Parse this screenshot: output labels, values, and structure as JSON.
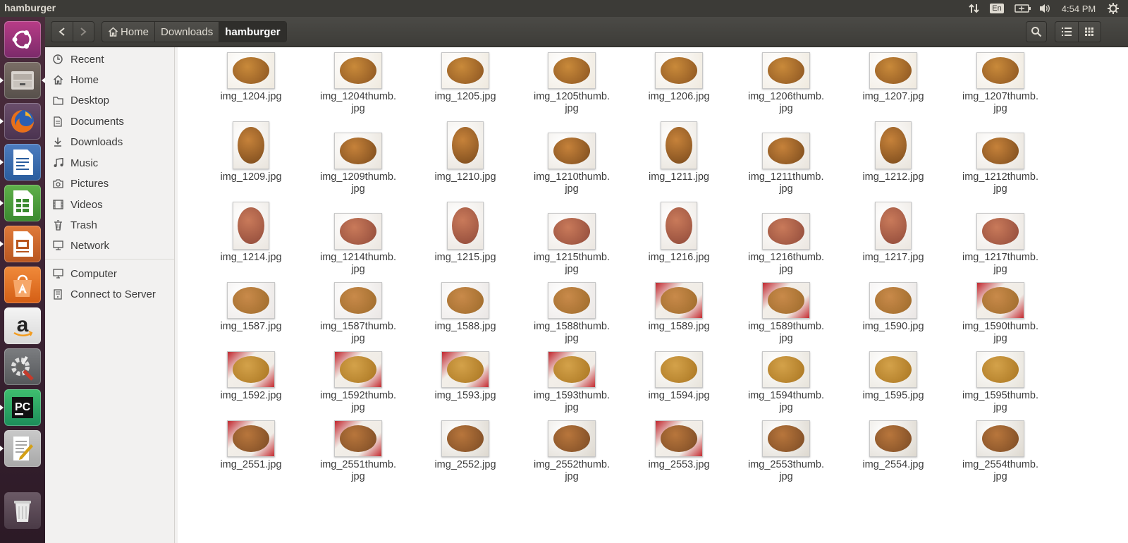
{
  "window": {
    "title": "hamburger"
  },
  "panel": {
    "keyboard_layout": "En",
    "clock": "4:54 PM"
  },
  "launcher": {
    "items": [
      {
        "name": "ubuntu-dash-icon"
      },
      {
        "name": "files-icon"
      },
      {
        "name": "firefox-icon"
      },
      {
        "name": "writer-icon"
      },
      {
        "name": "calc-icon"
      },
      {
        "name": "impress-icon"
      },
      {
        "name": "software-center-icon"
      },
      {
        "name": "amazon-icon"
      },
      {
        "name": "system-settings-icon"
      },
      {
        "name": "pycharm-icon"
      },
      {
        "name": "text-editor-icon"
      },
      {
        "name": "trash-icon"
      }
    ]
  },
  "breadcrumb": {
    "items": [
      "Home",
      "Downloads",
      "hamburger"
    ]
  },
  "sidebar": {
    "places": [
      {
        "label": "Recent",
        "icon": "clock-icon"
      },
      {
        "label": "Home",
        "icon": "home-icon"
      },
      {
        "label": "Desktop",
        "icon": "folder-icon"
      },
      {
        "label": "Documents",
        "icon": "document-icon"
      },
      {
        "label": "Downloads",
        "icon": "download-icon"
      },
      {
        "label": "Music",
        "icon": "music-icon"
      },
      {
        "label": "Pictures",
        "icon": "camera-icon"
      },
      {
        "label": "Videos",
        "icon": "video-icon"
      },
      {
        "label": "Trash",
        "icon": "trash-icon"
      },
      {
        "label": "Network",
        "icon": "network-icon"
      }
    ],
    "devices": [
      {
        "label": "Computer",
        "icon": "computer-icon"
      },
      {
        "label": "Connect to Server",
        "icon": "server-icon"
      }
    ]
  },
  "files": [
    [
      "img_1204.jpg",
      "img_1204thumb.jpg",
      "img_1205.jpg",
      "img_1205thumb.jpg",
      "img_1206.jpg",
      "img_1206thumb.jpg",
      "img_1207.jpg",
      "img_1207thumb.jpg"
    ],
    [
      "img_1209.jpg",
      "img_1209thumb.jpg",
      "img_1210.jpg",
      "img_1210thumb.jpg",
      "img_1211.jpg",
      "img_1211thumb.jpg",
      "img_1212.jpg",
      "img_1212thumb.jpg"
    ],
    [
      "img_1214.jpg",
      "img_1214thumb.jpg",
      "img_1215.jpg",
      "img_1215thumb.jpg",
      "img_1216.jpg",
      "img_1216thumb.jpg",
      "img_1217.jpg",
      "img_1217thumb.jpg"
    ],
    [
      "img_1587.jpg",
      "img_1587thumb.jpg",
      "img_1588.jpg",
      "img_1588thumb.jpg",
      "img_1589.jpg",
      "img_1589thumb.jpg",
      "img_1590.jpg",
      "img_1590thumb.jpg"
    ],
    [
      "img_1592.jpg",
      "img_1592thumb.jpg",
      "img_1593.jpg",
      "img_1593thumb.jpg",
      "img_1594.jpg",
      "img_1594thumb.jpg",
      "img_1595.jpg",
      "img_1595thumb.jpg"
    ],
    [
      "img_2551.jpg",
      "img_2551thumb.jpg",
      "img_2552.jpg",
      "img_2552thumb.jpg",
      "img_2553.jpg",
      "img_2553thumb.jpg",
      "img_2554.jpg",
      "img_2554thumb.jpg"
    ]
  ],
  "colors": {
    "launcher_bg": "#3a2232",
    "panel_bg": "#3c3b37",
    "header_bg": "#3d3c38",
    "sidebar_bg": "#f2f1f0"
  }
}
